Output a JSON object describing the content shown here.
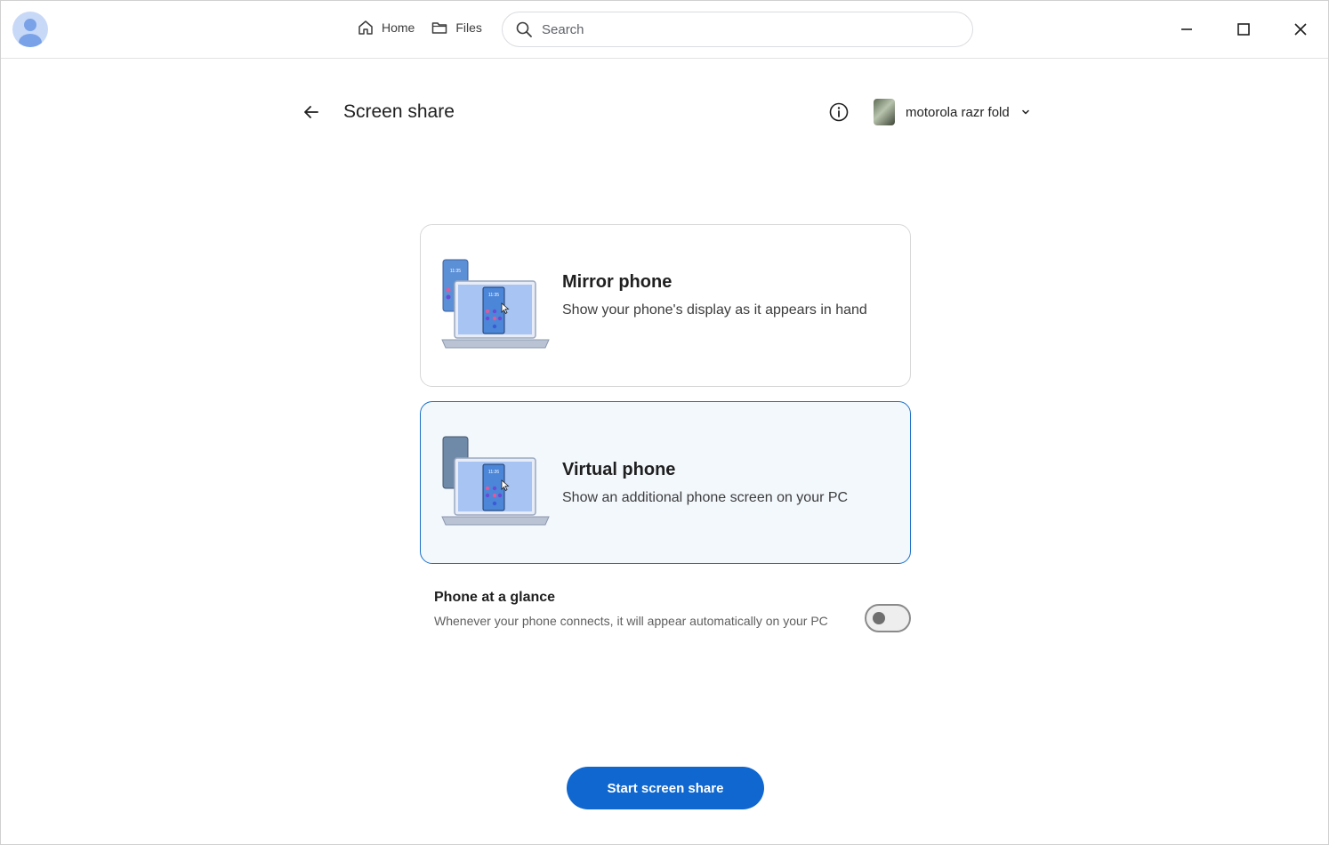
{
  "nav": {
    "home_label": "Home",
    "files_label": "Files"
  },
  "search": {
    "placeholder": "Search"
  },
  "header": {
    "title": "Screen share",
    "device_name": "motorola razr fold"
  },
  "options": [
    {
      "title": "Mirror phone",
      "description": "Show your phone's display as it appears in hand",
      "screen_time": "11:35",
      "selected": false
    },
    {
      "title": "Virtual phone",
      "description": "Show an additional phone screen on your PC",
      "screen_time": "11:26",
      "selected": true
    }
  ],
  "glance": {
    "title": "Phone at a glance",
    "description": "Whenever your phone connects, it will appear automatically on your PC",
    "enabled": false
  },
  "actions": {
    "start_label": "Start screen share"
  },
  "colors": {
    "accent": "#0f67cf",
    "selected_border": "#1a6fc8",
    "selected_bg": "#f3f8fd"
  }
}
